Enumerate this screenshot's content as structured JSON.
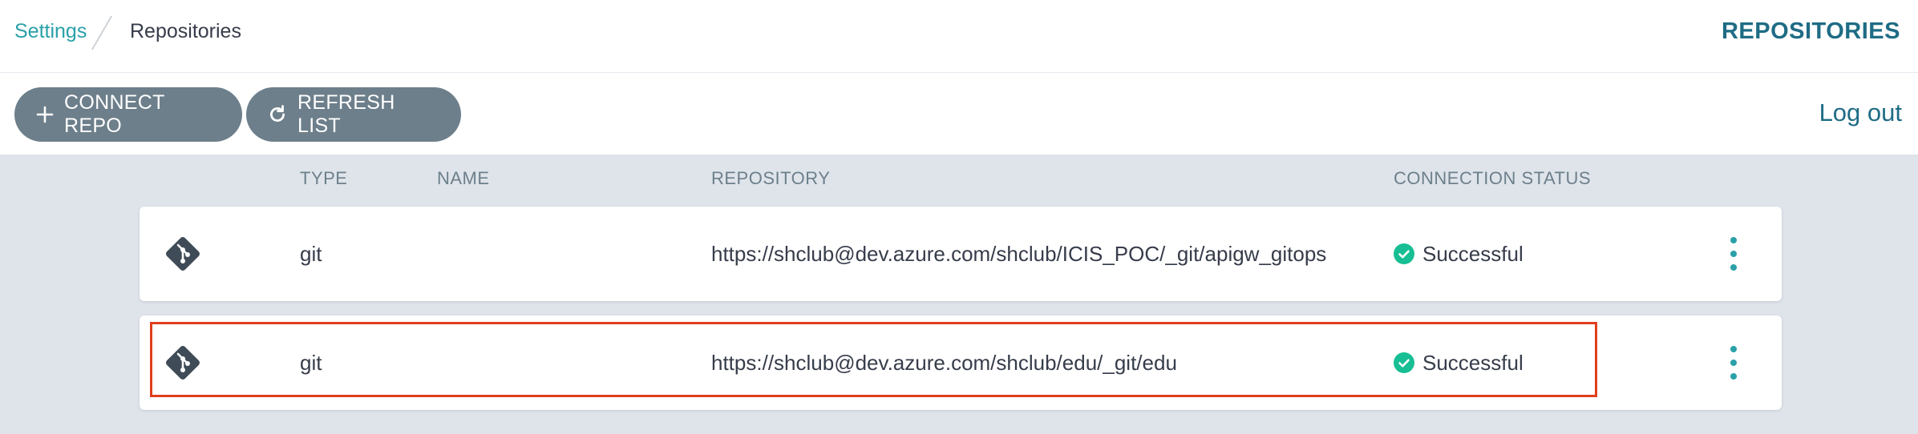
{
  "breadcrumb": {
    "parent": "Settings",
    "current": "Repositories"
  },
  "page_heading": "REPOSITORIES",
  "toolbar": {
    "connect_label": "CONNECT REPO",
    "refresh_label": "REFRESH LIST",
    "logout_label": "Log out"
  },
  "table": {
    "columns": {
      "type": "TYPE",
      "name": "NAME",
      "repository": "REPOSITORY",
      "status": "CONNECTION STATUS"
    },
    "rows": [
      {
        "type": "git",
        "name": "",
        "repository": "https://shclub@dev.azure.com/shclub/ICIS_POC/_git/apigw_gitops",
        "status": "Successful"
      },
      {
        "type": "git",
        "name": "",
        "repository": "https://shclub@dev.azure.com/shclub/edu/_git/edu",
        "status": "Successful"
      }
    ]
  },
  "colors": {
    "accent": "#2aa0a8",
    "heading": "#1e6c85",
    "button": "#6d7f8b",
    "success": "#18be94",
    "highlight": "#e03e1d"
  },
  "icons": {
    "connect": "plus-icon",
    "refresh": "refresh-icon",
    "repo": "git-icon",
    "status": "check-circle-icon",
    "menu": "kebab-menu-icon"
  }
}
